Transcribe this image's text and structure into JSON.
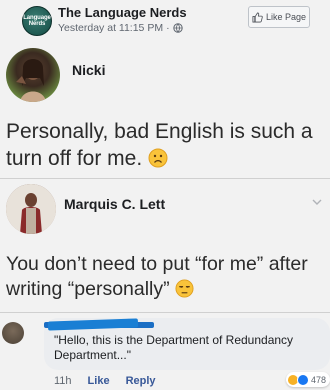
{
  "post": {
    "page_name": "The Language Nerds",
    "logo_text": "Language Nerds",
    "timestamp": "Yesterday at 11:15 PM",
    "separator": "·",
    "like_page_label": "Like Page"
  },
  "image_content": {
    "comment1": {
      "author": "Nicki",
      "text": "Personally, bad English is such a turn off for me."
    },
    "comment2": {
      "author": "Marquis C. Lett",
      "text": "You don’t need to put “for me” after writing “personally”"
    }
  },
  "fb_comment": {
    "text": "\"Hello, this is the Department of Redundancy Department...\"",
    "time": "11h",
    "like_label": "Like",
    "reply_label": "Reply",
    "reaction_count": "478",
    "redaction_color": "#1a7fd4"
  },
  "colors": {
    "link": "#385898",
    "background": "#f2f2f2"
  }
}
